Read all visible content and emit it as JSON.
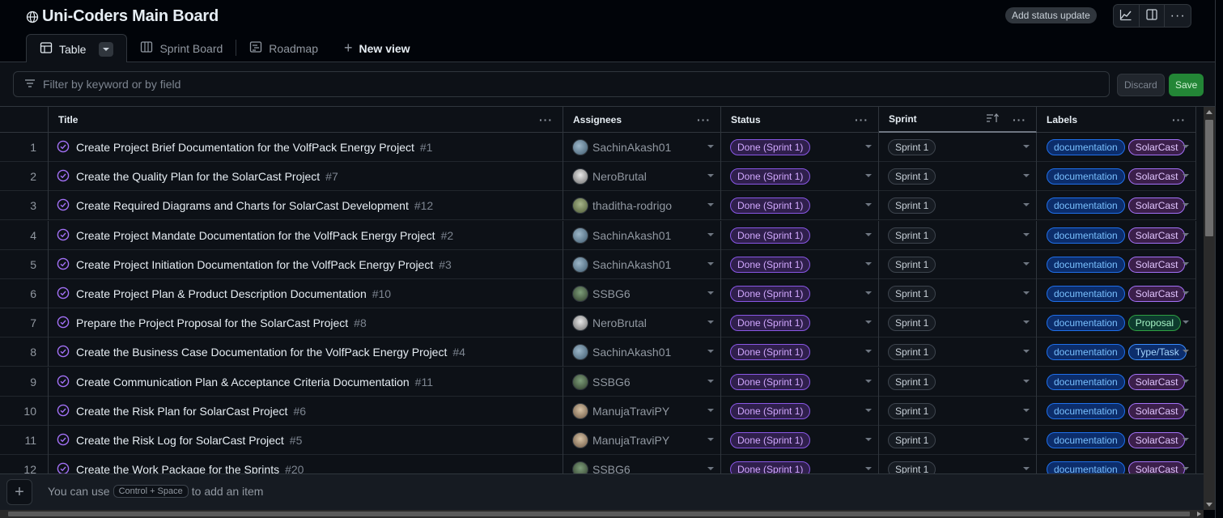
{
  "header": {
    "title": "Uni-Coders Main Board",
    "status_button": "Add status update"
  },
  "tabs": [
    {
      "label": "Table",
      "icon": "table-icon"
    },
    {
      "label": "Sprint Board",
      "icon": "board-icon"
    },
    {
      "label": "Roadmap",
      "icon": "roadmap-icon"
    },
    {
      "label": "New view",
      "icon": "plus-icon"
    }
  ],
  "filter": {
    "placeholder": "Filter by keyword or by field",
    "discard_label": "Discard",
    "save_label": "Save"
  },
  "columns": [
    "Title",
    "Assignees",
    "Status",
    "Sprint",
    "Labels"
  ],
  "rows": [
    {
      "num": "1",
      "title": "Create Project Brief Documentation for the VolfPack Energy Project",
      "issue": "#1",
      "assignee": "SachinAkash01",
      "status": "Done (Sprint 1)",
      "sprint": "Sprint 1",
      "labels": [
        "documentation",
        "SolarCast"
      ]
    },
    {
      "num": "2",
      "title": "Create the Quality Plan for the SolarCast Project",
      "issue": "#7",
      "assignee": "NeroBrutal",
      "status": "Done (Sprint 1)",
      "sprint": "Sprint 1",
      "labels": [
        "documentation",
        "SolarCast"
      ]
    },
    {
      "num": "3",
      "title": "Create Required Diagrams and Charts for SolarCast Development",
      "issue": "#12",
      "assignee": "thaditha-rodrigo",
      "status": "Done (Sprint 1)",
      "sprint": "Sprint 1",
      "labels": [
        "documentation",
        "SolarCast"
      ]
    },
    {
      "num": "4",
      "title": "Create Project Mandate Documentation for the VolfPack Energy Project",
      "issue": "#2",
      "assignee": "SachinAkash01",
      "status": "Done (Sprint 1)",
      "sprint": "Sprint 1",
      "labels": [
        "documentation",
        "SolarCast"
      ]
    },
    {
      "num": "5",
      "title": "Create Project Initiation Documentation for the VolfPack Energy Project",
      "issue": "#3",
      "assignee": "SachinAkash01",
      "status": "Done (Sprint 1)",
      "sprint": "Sprint 1",
      "labels": [
        "documentation",
        "SolarCast"
      ]
    },
    {
      "num": "6",
      "title": "Create Project Plan & Product Description Documentation",
      "issue": "#10",
      "assignee": "SSBG6",
      "status": "Done (Sprint 1)",
      "sprint": "Sprint 1",
      "labels": [
        "documentation",
        "SolarCast"
      ]
    },
    {
      "num": "7",
      "title": "Prepare the Project Proposal for the SolarCast Project",
      "issue": "#8",
      "assignee": "NeroBrutal",
      "status": "Done (Sprint 1)",
      "sprint": "Sprint 1",
      "labels": [
        "documentation",
        "Proposal"
      ]
    },
    {
      "num": "8",
      "title": "Create the Business Case Documentation for the VolfPack Energy Project",
      "issue": "#4",
      "assignee": "SachinAkash01",
      "status": "Done (Sprint 1)",
      "sprint": "Sprint 1",
      "labels": [
        "documentation",
        "Type/Task"
      ]
    },
    {
      "num": "9",
      "title": "Create Communication Plan & Acceptance Criteria Documentation",
      "issue": "#11",
      "assignee": "SSBG6",
      "status": "Done (Sprint 1)",
      "sprint": "Sprint 1",
      "labels": [
        "documentation",
        "SolarCast"
      ]
    },
    {
      "num": "10",
      "title": "Create the Risk Plan for SolarCast Project",
      "issue": "#6",
      "assignee": "ManujaTraviPY",
      "status": "Done (Sprint 1)",
      "sprint": "Sprint 1",
      "labels": [
        "documentation",
        "SolarCast"
      ]
    },
    {
      "num": "11",
      "title": "Create the Risk Log for SolarCast Project",
      "issue": "#5",
      "assignee": "ManujaTraviPY",
      "status": "Done (Sprint 1)",
      "sprint": "Sprint 1",
      "labels": [
        "documentation",
        "SolarCast"
      ]
    },
    {
      "num": "12",
      "title": "Create the Work Package for the Sprints",
      "issue": "#20",
      "assignee": "SSBG6",
      "status": "Done (Sprint 1)",
      "sprint": "Sprint 1",
      "labels": [
        "documentation",
        "SolarCast"
      ]
    }
  ],
  "footer": {
    "prefix": "You can use",
    "shortcut": "Control + Space",
    "suffix": "to add an item"
  },
  "colors": {
    "status_done": "#8957e5",
    "label_documentation": "#1f6feb",
    "label_solarcast": "#a371f7",
    "label_proposal": "#2ea043",
    "save_button": "#238636"
  }
}
